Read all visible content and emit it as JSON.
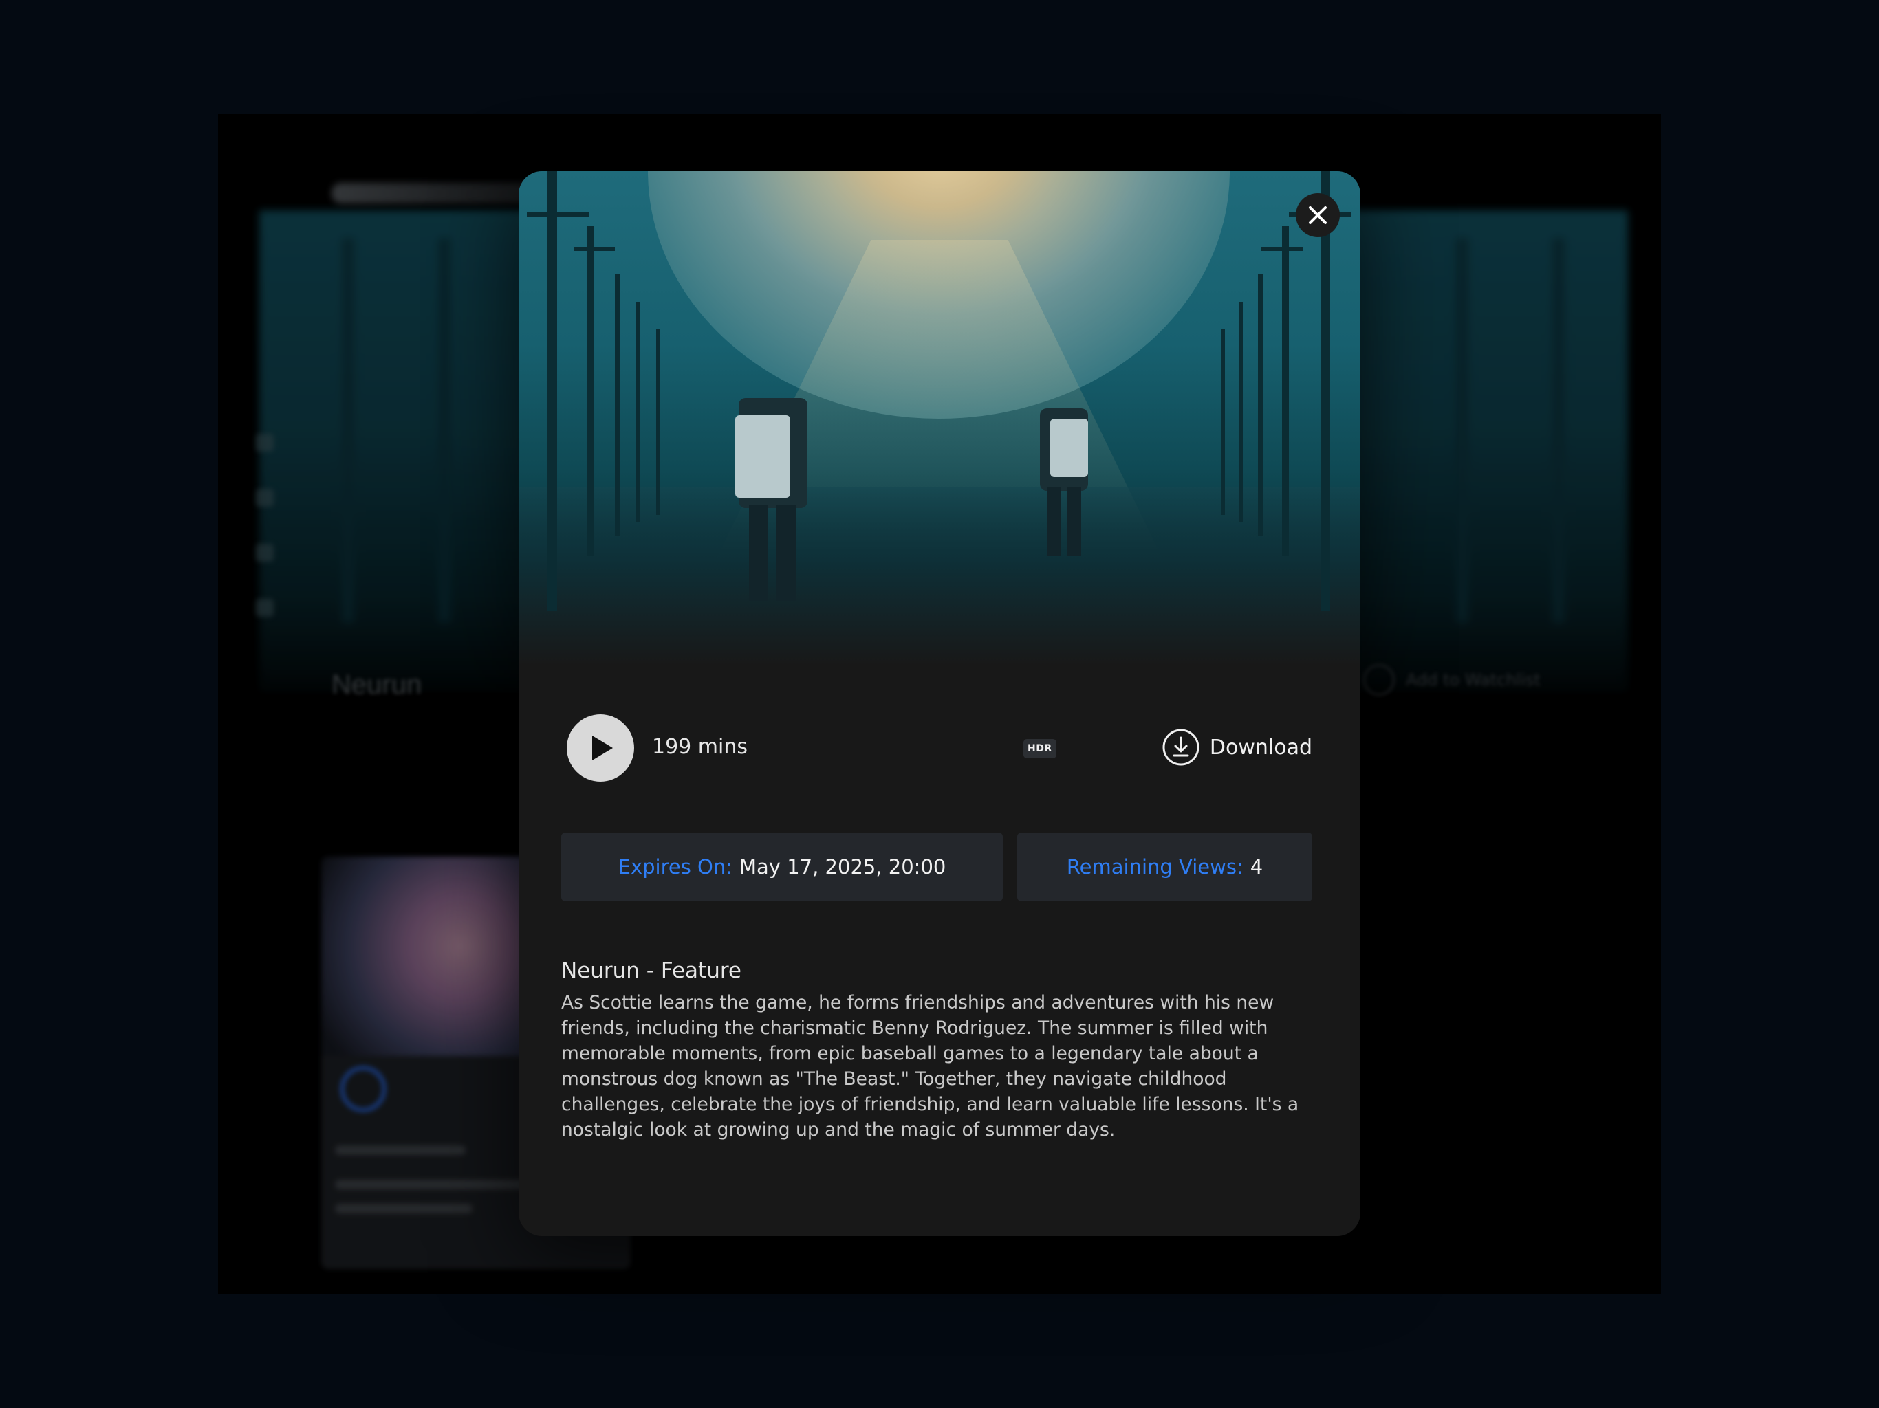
{
  "modal": {
    "duration": "199 mins",
    "quality_badge": "HDR",
    "download_label": "Download",
    "expires": {
      "label": "Expires On:",
      "value": "May 17, 2025, 20:00"
    },
    "remaining_views": {
      "label": "Remaining Views:",
      "value": "4"
    },
    "title": "Neurun - Feature",
    "description": "As Scottie learns the game, he forms friendships and adventures with his new friends, including the charismatic Benny Rodriguez. The summer is filled with memorable moments, from epic baseball games to a legendary tale about a monstrous dog known as \"The Beast.\" Together, they navigate childhood challenges, celebrate the joys of friendship, and learn valuable life lessons. It's a nostalgic look at growing up and the magic of summer days.",
    "icons": {
      "close": "close-icon",
      "play": "play-icon",
      "download": "download-icon"
    }
  },
  "background": {
    "page_title": "Neurun",
    "watchlist_label": "Add to Watchlist"
  },
  "colors": {
    "accent_blue": "#2f7ef5",
    "modal_bg": "#181818",
    "info_box_bg": "#24272c",
    "page_bg": "#040a12"
  }
}
